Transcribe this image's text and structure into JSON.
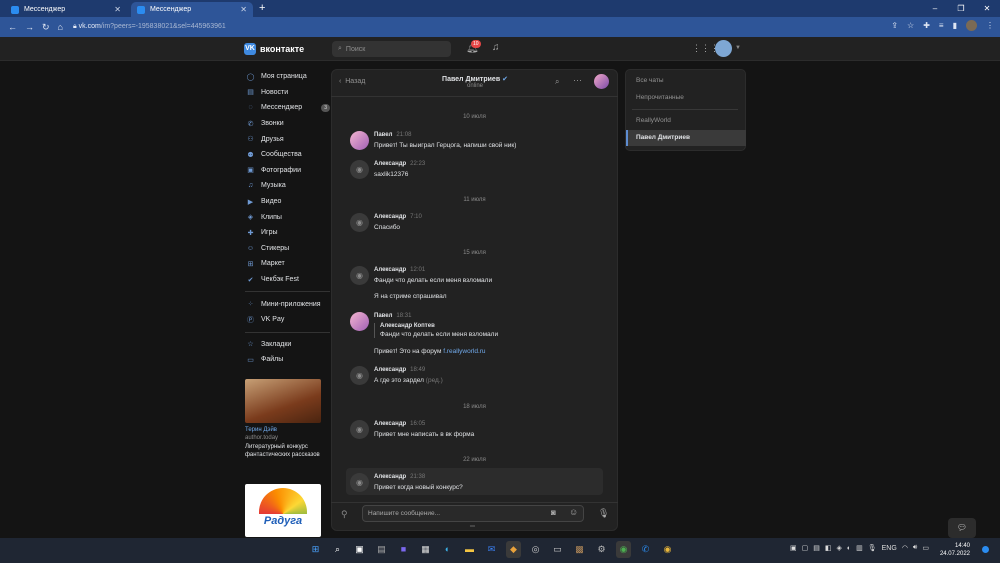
{
  "browser": {
    "tabs": [
      {
        "label": "Мессенджер"
      },
      {
        "label": "Мессенджер"
      }
    ],
    "url_host": "vk.com",
    "url_path": "/im?peers=-195838021&sel=445963961"
  },
  "header": {
    "logo_text": "вконтакте",
    "search_placeholder": "Поиск",
    "notification_count": "10"
  },
  "sidebar": {
    "items": [
      {
        "label": "Моя страница",
        "icon": "user-icon"
      },
      {
        "label": "Новости",
        "icon": "news-icon"
      },
      {
        "label": "Мессенджер",
        "icon": "message-icon",
        "badge": "3"
      },
      {
        "label": "Звонки",
        "icon": "phone-icon"
      },
      {
        "label": "Друзья",
        "icon": "friends-icon"
      },
      {
        "label": "Сообщества",
        "icon": "groups-icon"
      },
      {
        "label": "Фотографии",
        "icon": "photo-icon"
      },
      {
        "label": "Музыка",
        "icon": "music-icon"
      },
      {
        "label": "Видео",
        "icon": "video-icon"
      },
      {
        "label": "Клипы",
        "icon": "clips-icon"
      },
      {
        "label": "Игры",
        "icon": "games-icon"
      },
      {
        "label": "Стикеры",
        "icon": "stickers-icon"
      },
      {
        "label": "Маркет",
        "icon": "market-icon"
      },
      {
        "label": "Чекбэк Fest",
        "icon": "check-icon"
      }
    ],
    "items2": [
      {
        "label": "Мини-приложения",
        "icon": "apps-icon"
      },
      {
        "label": "VK Pay",
        "icon": "pay-icon"
      }
    ],
    "items3": [
      {
        "label": "Закладки",
        "icon": "bookmark-icon"
      },
      {
        "label": "Файлы",
        "icon": "file-icon"
      }
    ],
    "ad1": {
      "title": "Терин Дэйв",
      "sub": "author.today",
      "desc": "Литературный конкурс фантастических рассказов"
    },
    "ad2": {
      "logo_text": "Радуга"
    }
  },
  "chat": {
    "back_label": "Назад",
    "peer_name": "Павел Дмитриев",
    "peer_status": "online",
    "input_placeholder": "Напишите сообщение...",
    "dates": [
      "10 июля",
      "11 июля",
      "15 июля",
      "18 июля",
      "22 июля"
    ],
    "messages": [
      {
        "author": "Павел",
        "time": "21:08",
        "text": "Привет! Ты выиграл Герцога, напиши свой ник)"
      },
      {
        "author": "Александр",
        "time": "22:23",
        "text": "saxlik12376"
      },
      {
        "author": "Александр",
        "time": "7:10",
        "text": "Спасибо"
      },
      {
        "author": "Александр",
        "time": "12:01",
        "text": "Фанди что делать если меня взломали"
      },
      {
        "text": "Я на стриме спрашивал"
      },
      {
        "author": "Павел",
        "time": "18:31",
        "fwd_author": "Александр Коптев",
        "fwd_text": "Фанди что делать если меня взломали",
        "text": "Привет! Это на форум",
        "link": "f.reallyworld.ru"
      },
      {
        "author": "Александр",
        "time": "18:49",
        "text": "А где это зардел",
        "edit": "(ред.)"
      },
      {
        "author": "Александр",
        "time": "16:05",
        "text": "Привет мне написать в вк форма"
      },
      {
        "author": "Александр",
        "time": "21:38",
        "text": "Привет когда новый конкурс?"
      }
    ]
  },
  "filters": {
    "all": "Все чаты",
    "unread": "Непрочитанные",
    "folder1": "ReallyWorld",
    "folder2": "Павел Дмитриев"
  },
  "taskbar": {
    "lang": "ENG",
    "time": "14:40",
    "date": "24.07.2022"
  }
}
